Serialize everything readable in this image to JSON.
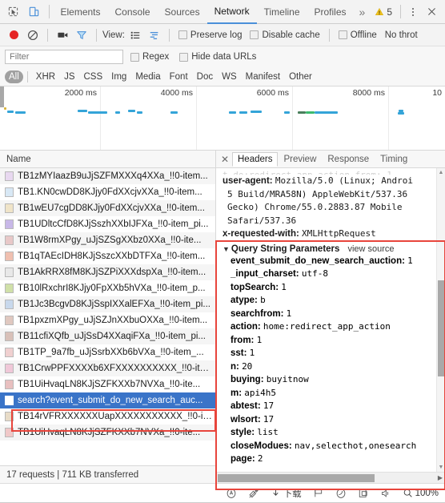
{
  "topbar": {
    "inspect_icon": "inspect-cursor-icon",
    "device_icon": "device-toolbar-icon",
    "tabs": [
      {
        "label": "Elements",
        "active": false
      },
      {
        "label": "Console",
        "active": false
      },
      {
        "label": "Sources",
        "active": false
      },
      {
        "label": "Network",
        "active": true
      },
      {
        "label": "Timeline",
        "active": false
      },
      {
        "label": "Profiles",
        "active": false
      }
    ],
    "more_label": "»",
    "warning_count": "5",
    "warning_icon": "warning-triangle-icon",
    "menu_icon": "kebab-menu-icon",
    "close_icon": "close-icon"
  },
  "nettoolbar": {
    "record_icon": "record-button-icon",
    "clear_icon": "clear-icon",
    "camera_icon": "capture-screenshots-icon",
    "filter_icon": "filter-funnel-icon",
    "view_label": "View:",
    "list_view_icon": "list-view-icon",
    "waterfall_view_icon": "waterfall-view-icon",
    "preserve_log_label": "Preserve log",
    "disable_cache_label": "Disable cache",
    "offline_label": "Offline",
    "throttle_label": "No throt"
  },
  "filterbar": {
    "placeholder": "Filter",
    "value": "",
    "regex_label": "Regex",
    "hide_data_urls_label": "Hide data URLs"
  },
  "typefilters": [
    {
      "label": "All",
      "selected": true
    },
    {
      "label": "XHR",
      "selected": false
    },
    {
      "label": "JS",
      "selected": false
    },
    {
      "label": "CSS",
      "selected": false
    },
    {
      "label": "Img",
      "selected": false
    },
    {
      "label": "Media",
      "selected": false
    },
    {
      "label": "Font",
      "selected": false
    },
    {
      "label": "Doc",
      "selected": false
    },
    {
      "label": "WS",
      "selected": false
    },
    {
      "label": "Manifest",
      "selected": false
    },
    {
      "label": "Other",
      "selected": false
    }
  ],
  "overview": {
    "ticks": [
      "2000 ms",
      "4000 ms",
      "6000 ms",
      "8000 ms",
      "10"
    ],
    "bar_color": "#34a4d8",
    "bar_color_alt": "#3cba6e"
  },
  "requests": {
    "column_header": "Name",
    "rows": [
      {
        "name": "TB1zMYIaazB9uJjSZFMXXXq4XXa_!!0-item..."
      },
      {
        "name": "TB1.KN0cwDD8KJjy0FdXXcjvXXa_!!0-item..."
      },
      {
        "name": "TB1wEU7cgDD8KJjy0FdXXcjvXXa_!!0-item..."
      },
      {
        "name": "TB1UDltcCfD8KJjSszhXXbIJFXa_!!0-item_pi..."
      },
      {
        "name": "TB1W8rmXPgy_uJjSZSgXXbz0XXa_!!0-ite..."
      },
      {
        "name": "TB1qTAEcIDH8KJjSszcXXbDTFXa_!!0-item..."
      },
      {
        "name": "TB1AkRRX8fM8KJjSZPiXXXdspXa_!!0-item..."
      },
      {
        "name": "TB10lRxchrI8KJjy0FpXXb5hVXa_!!0-item_p..."
      },
      {
        "name": "TB1Jc3BcgvD8KJjSspIXXalEFXa_!!0-item_pi..."
      },
      {
        "name": "TB1pxzmXPgy_uJjSZJnXXbuOXXa_!!0-item..."
      },
      {
        "name": "TB11cfiXQfb_uJjSsD4XXaqiFXa_!!0-item_pi..."
      },
      {
        "name": "TB1TP_9a7fb_uJjSsrbXXb6bVXa_!!0-item_..."
      },
      {
        "name": "TB1CrwPPFXXXXb6XFXXXXXXXXXX_!!0-ite..."
      },
      {
        "name": "TB1UiHvaqLN8KJjSZFKXXb7NVXa_!!0-ite..."
      },
      {
        "name": "search?event_submit_do_new_search_auc...",
        "selected": true
      },
      {
        "name": "TB14rVFRXXXXXXUapXXXXXXXXXXX_!!0-ite..."
      },
      {
        "name": "TB1UiHvaqLN8KJjSZFKXXb7NVXa_!!0-ite..."
      }
    ],
    "footer": "17 requests  |  711 KB transferred"
  },
  "detail": {
    "close_icon": "close-panel-icon",
    "tabs": [
      {
        "label": "Headers",
        "active": true
      },
      {
        "label": "Preview",
        "active": false
      },
      {
        "label": "Response",
        "active": false
      },
      {
        "label": "Timing",
        "active": false
      }
    ],
    "cut_line": "t.do:redirect_app_action.from: 1",
    "headers": [
      {
        "key": "user-agent:",
        "value": "Mozilla/5.0 (Linux; Androi"
      },
      {
        "key": "",
        "value": "5 Build/MRA58N) AppleWebKit/537.36"
      },
      {
        "key": "",
        "value": "Gecko) Chrome/55.0.2883.87 Mobile"
      },
      {
        "key": "",
        "value": "Safari/537.36"
      },
      {
        "key": "x-requested-with:",
        "value": "XMLHttpRequest"
      }
    ],
    "qsp": {
      "title": "Query String Parameters",
      "view_source": "view source",
      "params": [
        {
          "key": "event_submit_do_new_search_auction:",
          "value": "1"
        },
        {
          "key": "_input_charset:",
          "value": "utf-8"
        },
        {
          "key": "topSearch:",
          "value": "1"
        },
        {
          "key": "atype:",
          "value": "b"
        },
        {
          "key": "searchfrom:",
          "value": "1"
        },
        {
          "key": "action:",
          "value": "home:redirect_app_action"
        },
        {
          "key": "from:",
          "value": "1"
        },
        {
          "key": "sst:",
          "value": "1"
        },
        {
          "key": "n:",
          "value": "20"
        },
        {
          "key": "buying:",
          "value": "buyitnow"
        },
        {
          "key": "m:",
          "value": "api4h5"
        },
        {
          "key": "abtest:",
          "value": "17"
        },
        {
          "key": "wlsort:",
          "value": "17"
        },
        {
          "key": "style:",
          "value": "list"
        },
        {
          "key": "closeModues:",
          "value": "nav,selecthot,onesearch"
        },
        {
          "key": "page:",
          "value": "2"
        }
      ]
    }
  },
  "highlight": {
    "color": "#e8453c"
  },
  "bottombar": {
    "items": [
      {
        "icon": "annotate-icon",
        "label": ""
      },
      {
        "icon": "clip-note-icon",
        "label": ""
      },
      {
        "icon": "download-icon",
        "label": "下载"
      },
      {
        "icon": "flag-icon",
        "label": ""
      },
      {
        "icon": "eraser-icon",
        "label": ""
      },
      {
        "icon": "window-icon",
        "label": ""
      },
      {
        "icon": "speaker-icon",
        "label": ""
      },
      {
        "icon": "magnifier-icon",
        "label": "100%"
      }
    ],
    "zoom": "100%"
  }
}
